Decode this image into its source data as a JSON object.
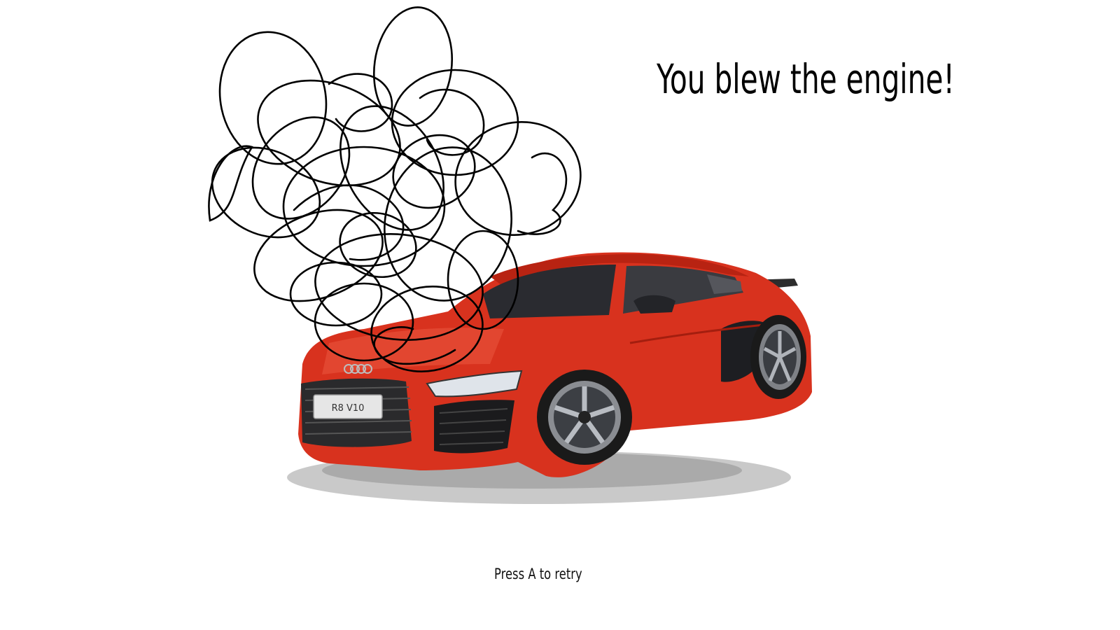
{
  "screen": {
    "message": "You blew the engine!",
    "prompt": "Press A to retry"
  },
  "car": {
    "license_plate": "R8 V10",
    "body_color": "#d8321e",
    "window_color": "#2a2b30"
  },
  "smoke": {
    "color": "#000000"
  }
}
